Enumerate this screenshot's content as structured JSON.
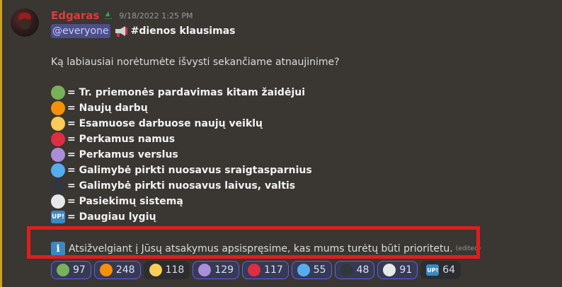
{
  "message": {
    "username": "Edgaras",
    "timestamp": "9/18/2022 1:25 PM",
    "mention": "@everyone",
    "channel_title": "#dienos klausimas",
    "question": "Ką labiausiai norėtumėte išvysti sekančiame atnaujinime?",
    "options": [
      {
        "color": "#78b159",
        "label": "= Tr. priemonės pardavimas kitam žaidėjui"
      },
      {
        "color": "#f4900c",
        "label": "= Naujų darbų"
      },
      {
        "color": "#fdcb58",
        "label": "= Esamuose darbuose naujų veiklų"
      },
      {
        "color": "#dd2e44",
        "label": "= Perkamus namus"
      },
      {
        "color": "#aa8ed6",
        "label": "= Perkamus verslus"
      },
      {
        "color": "#55acee",
        "label": "= Galimybė pirkti nuosavus sraigtasparnius"
      },
      {
        "color": "#31373d",
        "label": "= Galimybė pirkti nuosavus laivus, valtis"
      },
      {
        "color": "#e6e7e8",
        "label": "= Pasiekimų sistemą"
      },
      {
        "badge": "UP!",
        "label": "= Daugiau lygių"
      }
    ],
    "info_badge": "i",
    "info_text": "Atsižvelgiant į Jūsų atsakymus apsispręsime, kas mums turėtų būti prioritetu.",
    "edited": "(edited)"
  },
  "reactions": [
    {
      "color": "#78b159",
      "count": "97",
      "active": true
    },
    {
      "color": "#f4900c",
      "count": "248",
      "active": true
    },
    {
      "color": "#fdcb58",
      "count": "118",
      "active": false
    },
    {
      "color": "#aa8ed6",
      "count": "129",
      "active": true
    },
    {
      "color": "#dd2e44",
      "count": "117",
      "active": true
    },
    {
      "color": "#55acee",
      "count": "55",
      "active": true
    },
    {
      "color": "#31373d",
      "count": "48",
      "active": true
    },
    {
      "color": "#e6e7e8",
      "count": "91",
      "active": true
    },
    {
      "badge": "UP!",
      "count": "64",
      "active": false
    }
  ],
  "colors": {
    "username": "#e03b3b",
    "highlight_border": "#e01e1e",
    "mention_bg": "#4c4f88"
  }
}
